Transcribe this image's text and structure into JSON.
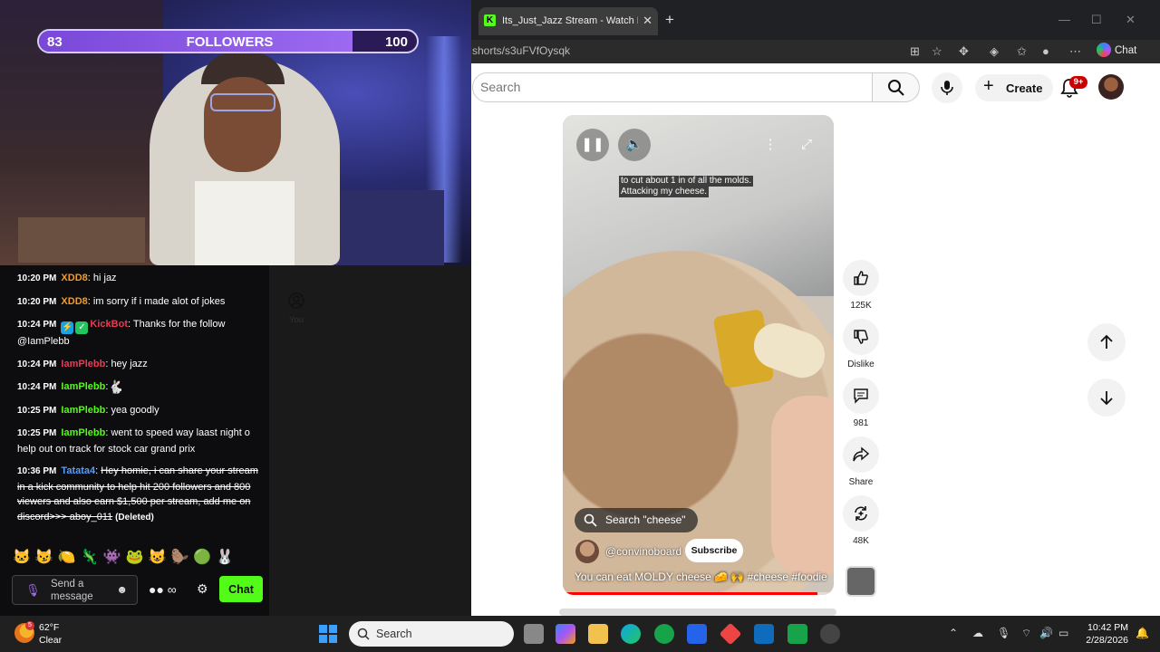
{
  "overlay": {
    "followers": {
      "current": "83",
      "label": "FOLLOWERS",
      "goal": "100",
      "progress": 0.83
    }
  },
  "chat": {
    "messages": [
      {
        "time": "10:20 PM",
        "user": "XDD8",
        "user_color": "#f39c2a",
        "text": ": hi jaz",
        "deleted": false
      },
      {
        "time": "10:20 PM",
        "user": "XDD8",
        "user_color": "#f39c2a",
        "text": ": im sorry if i made alot of jokes",
        "deleted": false
      },
      {
        "time": "10:24 PM",
        "user": "KickBot",
        "user_color": "#e93b54",
        "text": ": Thanks for the follow @IamPlebb",
        "deleted": false,
        "badges": [
          "bot-badge-icon",
          "verified-badge-icon"
        ]
      },
      {
        "time": "10:24 PM",
        "user": "IamPlebb",
        "user_color": "#e93b54",
        "text": ": hey jazz",
        "deleted": false
      },
      {
        "time": "10:24 PM",
        "user": "IamPlebb",
        "user_color": "#53fc18",
        "text": ":",
        "deleted": false,
        "emote": "emote-icon"
      },
      {
        "time": "10:25 PM",
        "user": "IamPlebb",
        "user_color": "#53fc18",
        "text": ": yea goodly",
        "deleted": false
      },
      {
        "time": "10:25 PM",
        "user": "IamPlebb",
        "user_color": "#53fc18",
        "text": ": went to speed way laast night o help out on track for stock car grand prix",
        "deleted": false
      },
      {
        "time": "10:36 PM",
        "user": "Tatata4",
        "user_color": "#5b9cf5",
        "text": "Hey homie, i can share your stream in a kick community to help hit 200 followers and 800 viewers and also earn $1,500 per stream, add me on discord>>> aboy_011",
        "deleted": true,
        "deleted_label": "(Deleted)"
      }
    ],
    "input_placeholder": "Send a message",
    "send_label": "Chat"
  },
  "browser": {
    "tab_title": "Its_Just_Jazz Stream - Watch Live o",
    "url": "shorts/s3uFVfOysqk",
    "copilot_label": "Chat"
  },
  "youtube": {
    "search_placeholder": "Search",
    "create_label": "Create",
    "notifications": "9+",
    "nav_you": "You",
    "short": {
      "captions": [
        "to cut about 1 in of all the molds.",
        "Attacking my cheese."
      ],
      "search_chip": "Search \"cheese\"",
      "channel": "@convinoboard",
      "subscribe_label": "Subscribe",
      "title": "You can eat MOLDY cheese 🧀 🙌 #cheese #foodie",
      "progress": 0.94
    },
    "actions": {
      "likes": "125K",
      "dislike_label": "Dislike",
      "comments": "981",
      "share_label": "Share",
      "remix": "48K"
    }
  },
  "taskbar": {
    "temperature": "62°F",
    "weather": "Clear",
    "weather_badge": "5",
    "search_label": "Search",
    "time": "10:42 PM",
    "date": "2/28/2026"
  }
}
